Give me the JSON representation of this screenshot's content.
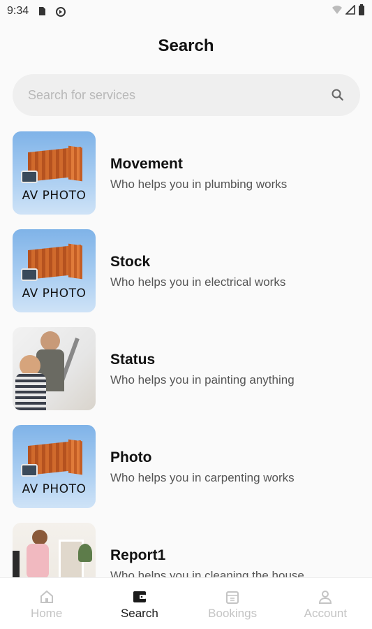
{
  "status_bar": {
    "time": "9:34",
    "icons": [
      "sd-card-icon",
      "sync-icon",
      "wifi-icon",
      "signal-icon",
      "battery-icon"
    ]
  },
  "header": {
    "title": "Search"
  },
  "search": {
    "placeholder": "Search for services",
    "icon": "search-icon"
  },
  "services": [
    {
      "name": "Movement",
      "description": "Who helps you in plumbing works",
      "thumbnail": "av-photo",
      "thumb_label": "AV PHOTO"
    },
    {
      "name": "Stock",
      "description": "Who helps you in electrical works",
      "thumbnail": "av-photo",
      "thumb_label": "AV PHOTO"
    },
    {
      "name": "Status",
      "description": "Who helps you in painting anything",
      "thumbnail": "painting-photo"
    },
    {
      "name": "Photo",
      "description": "Who helps you in carpenting works",
      "thumbnail": "av-photo",
      "thumb_label": "AV PHOTO"
    },
    {
      "name": "Report1",
      "description": "Who helps you in cleaning the house",
      "thumbnail": "cleaning-photo"
    }
  ],
  "bottom_nav": {
    "items": [
      {
        "label": "Home",
        "icon": "home-icon",
        "active": false
      },
      {
        "label": "Search",
        "icon": "wallet-icon",
        "active": true
      },
      {
        "label": "Bookings",
        "icon": "calendar-icon",
        "active": false
      },
      {
        "label": "Account",
        "icon": "person-icon",
        "active": false
      }
    ]
  },
  "colors": {
    "active_nav": "#1a1a1a",
    "inactive_nav": "#c4c4c4",
    "search_bg": "#efefef"
  }
}
